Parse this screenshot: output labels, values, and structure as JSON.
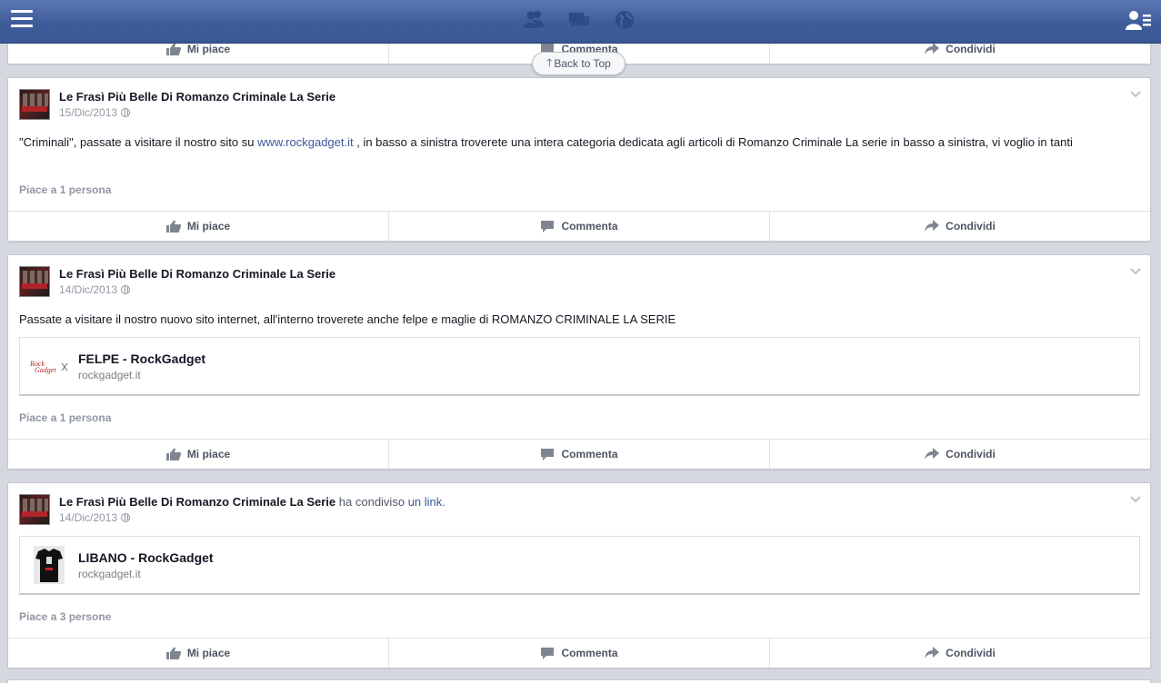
{
  "topbar": {
    "icons": [
      "friends-icon",
      "messages-icon",
      "notifications-globe-icon"
    ],
    "colors": {
      "bar": "#3b5998",
      "link": "#3b5998",
      "meta": "#9197a3"
    }
  },
  "back_to_top": {
    "label": "Back to Top"
  },
  "actions": {
    "like": "Mi piace",
    "comment": "Commenta",
    "share": "Condividi"
  },
  "posts": [
    {
      "author": "Le Frasì Più Belle Di Romanzo Criminale La Serie",
      "date": "15/Dic/2013",
      "text_before": "\"Criminali\", passate a visitare il nostro sito su ",
      "link": "www.rockgadget.it",
      "text_after": " , in basso a sinistra troverete una intera categoria dedicata agli articoli di Romanzo Criminale La serie in basso a sinistra, vi voglio in tanti",
      "likes": "Piace a 1 persona"
    },
    {
      "author": "Le Frasì Più Belle Di Romanzo Criminale La Serie",
      "date": "14/Dic/2013",
      "text": "Passate a visitare il nostro nuovo sito internet, all'interno troverete anche felpe e maglie di ROMANZO CRIMINALE LA SERIE",
      "link_title": "FELPE - RockGadget",
      "link_domain": "rockgadget.it",
      "likes": "Piace a 1 persona"
    },
    {
      "author": "Le Frasì Più Belle Di Romanzo Criminale La Serie",
      "shared_prefix": "ha condiviso",
      "shared_link": "un link.",
      "date": "14/Dic/2013",
      "link_title": "LIBANO - RockGadget",
      "link_domain": "rockgadget.it",
      "likes": "Piace a 3 persone"
    }
  ]
}
